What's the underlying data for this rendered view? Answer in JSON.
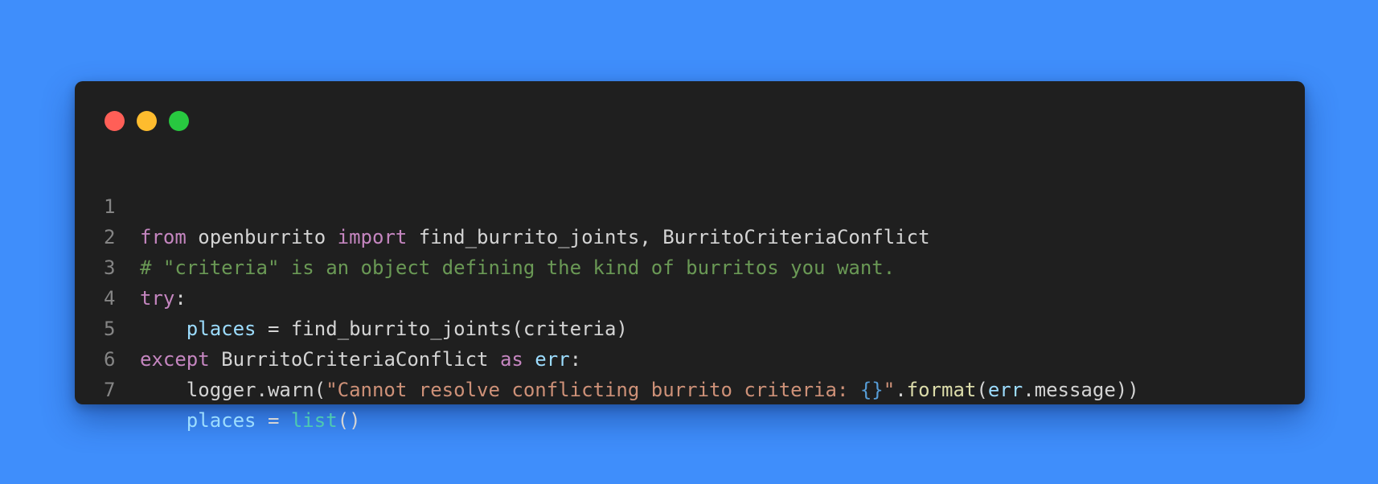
{
  "window": {
    "controls": [
      "close",
      "minimize",
      "maximize"
    ],
    "colors": {
      "background": "#3f8efb",
      "editor": "#1f1f1f",
      "close": "#ff5f57",
      "minimize": "#febc2e",
      "maximize": "#28c840"
    }
  },
  "code": {
    "lines": [
      {
        "number": "1",
        "tokens": {
          "t1": "from",
          "t2": " openburrito ",
          "t3": "import",
          "t4": " find_burrito_joints, BurritoCriteriaConflict"
        }
      },
      {
        "number": "2",
        "tokens": {
          "t1": "# \"criteria\" is an object defining the kind of burritos you want."
        }
      },
      {
        "number": "3",
        "tokens": {
          "t1": "try",
          "t2": ":"
        }
      },
      {
        "number": "4",
        "tokens": {
          "t1": "    ",
          "t2": "places",
          "t3": " = find_burrito_joints(criteria)"
        }
      },
      {
        "number": "5",
        "tokens": {
          "t1": "except",
          "t2": " BurritoCriteriaConflict ",
          "t3": "as",
          "t4": " ",
          "t5": "err",
          "t6": ":"
        }
      },
      {
        "number": "6",
        "tokens": {
          "t1": "    logger.warn(",
          "t2": "\"Cannot resolve conflicting burrito criteria: ",
          "t3": "{}",
          "t4": "\"",
          "t5": ".",
          "t6": "format",
          "t7": "(",
          "t8": "err",
          "t9": ".message))"
        }
      },
      {
        "number": "7",
        "tokens": {
          "t1": "    ",
          "t2": "places",
          "t3": " = ",
          "t4": "list",
          "t5": "()"
        }
      }
    ]
  }
}
